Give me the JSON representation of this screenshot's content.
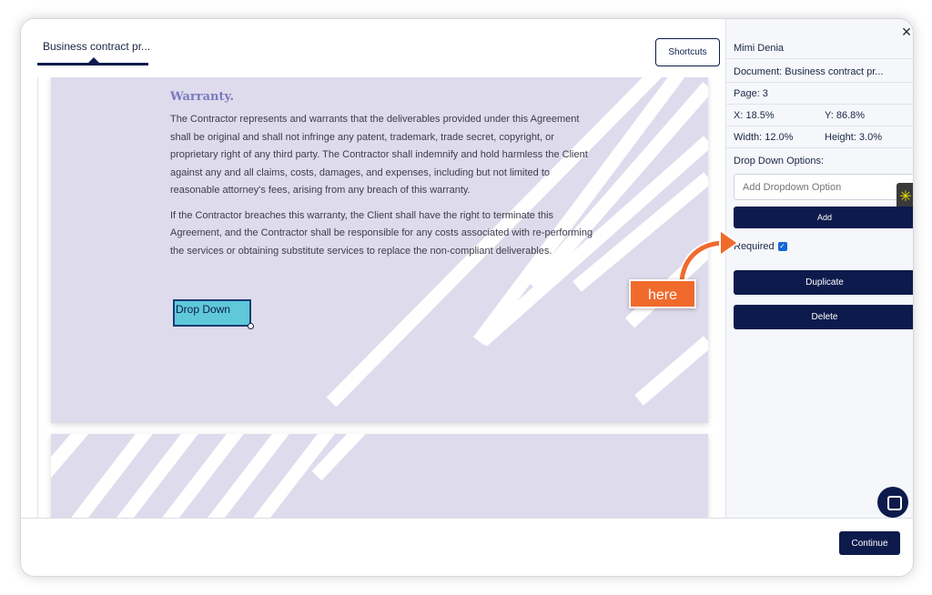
{
  "tab": {
    "label": "Business contract pr..."
  },
  "toolbar": {
    "shortcuts_label": "Shortcuts"
  },
  "document": {
    "heading": "Warranty.",
    "paragraphs": [
      "The Contractor represents and warrants that the deliverables provided under this Agreement shall be original and shall not infringe any patent, trademark, trade secret, copyright, or proprietary right of any third party. The Contractor shall indemnify and hold harmless the Client against any and all claims, costs, damages, and expenses, including but not limited to reasonable attorney's fees, arising from any breach of this warranty.",
      "If the Contractor breaches this warranty, the Client shall have the right to terminate this Agreement, and the Contractor shall be responsible for any costs associated with re-performing the services or obtaining substitute services to replace the non-compliant deliverables."
    ],
    "field_label": "Drop Down"
  },
  "panel": {
    "user_name": "Mimi Denia",
    "document_label": "Document: Business contract pr...",
    "page_label": "Page: 3",
    "x_label": "X: 18.5%",
    "y_label": "Y: 86.8%",
    "width_label": "Width: 12.0%",
    "height_label": "Height: 3.0%",
    "options_label": "Drop Down Options:",
    "option_placeholder": "Add Dropdown Option",
    "add_label": "Add",
    "required_label": "Required",
    "required_checked": true,
    "duplicate_label": "Duplicate",
    "delete_label": "Delete"
  },
  "footer": {
    "continue_label": "Continue"
  },
  "annotation": {
    "label": "here"
  },
  "colors": {
    "navy": "#0d1b4c",
    "page_bg": "#dedbed",
    "field_bg": "#5fc9d9",
    "annotation": "#f06a2c"
  },
  "icons": {
    "close": "close-icon",
    "chat": "chat-icon",
    "widget": "sparkle-icon"
  }
}
